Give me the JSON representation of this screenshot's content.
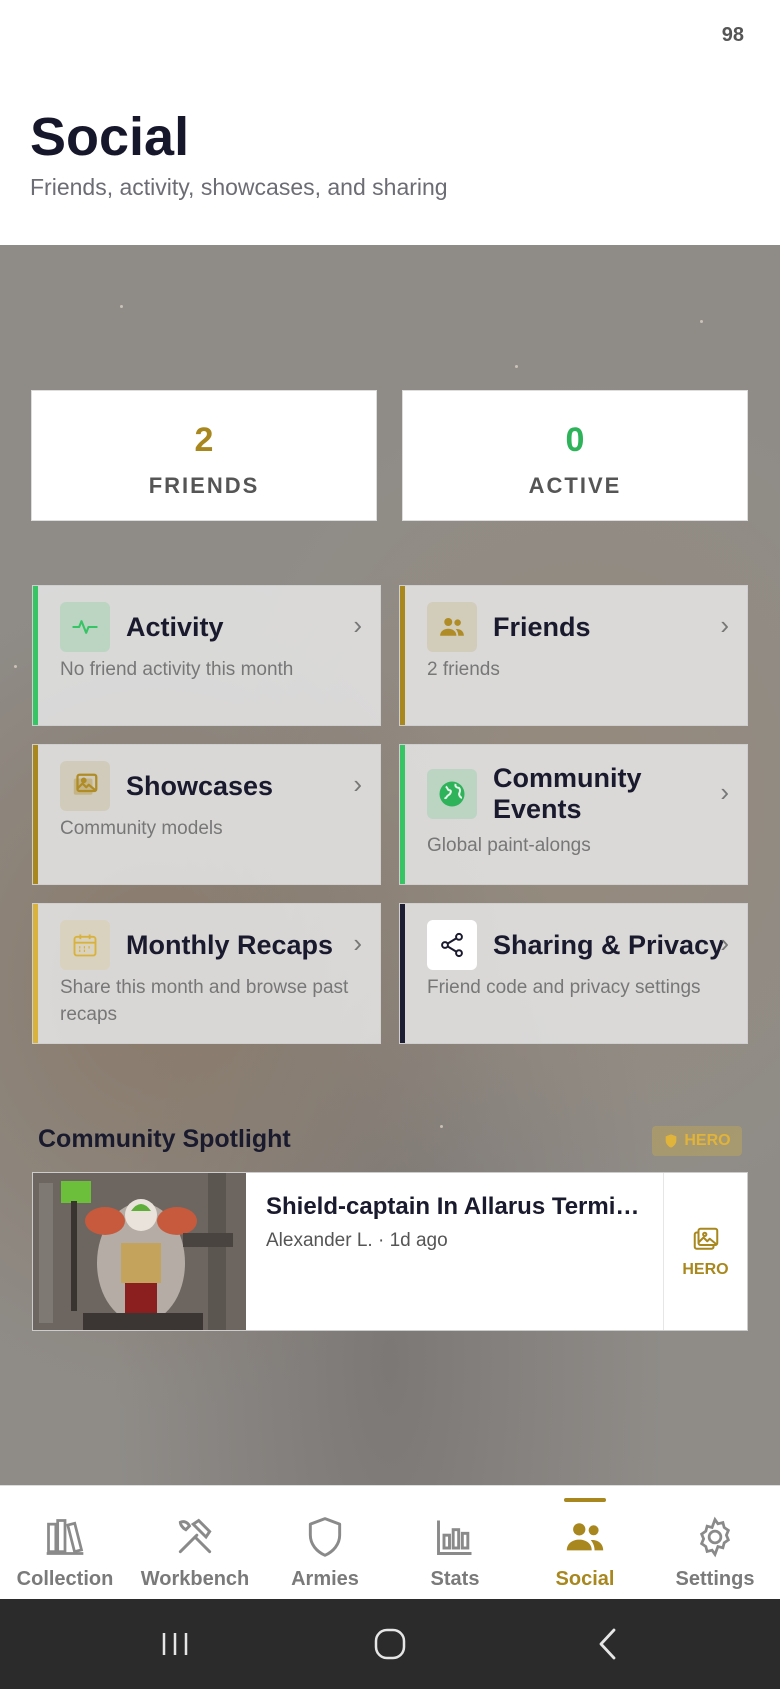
{
  "status_bar": {
    "battery": "98"
  },
  "header": {
    "title": "Social",
    "subtitle": "Friends, activity, showcases, and sharing"
  },
  "stats": [
    {
      "value": "2",
      "label": "FRIENDS",
      "color": "#a8871e"
    },
    {
      "value": "0",
      "label": "ACTIVE",
      "color": "#2fb35a"
    }
  ],
  "cards": [
    {
      "title": "Activity",
      "description": "No friend activity this month",
      "accent": "#36c464",
      "icon": "activity-pulse-icon"
    },
    {
      "title": "Friends",
      "description": "2 friends",
      "accent": "#a8871e",
      "icon": "people-icon"
    },
    {
      "title": "Showcases",
      "description": "Community models",
      "accent": "#a8871e",
      "icon": "image-icon"
    },
    {
      "title": "Community Events",
      "description": "Global paint-alongs",
      "accent": "#36c464",
      "icon": "globe-icon"
    },
    {
      "title": "Monthly Recaps",
      "description": "Share this month and browse past recaps",
      "accent": "#d9b23e",
      "icon": "calendar-icon"
    },
    {
      "title": "Sharing & Privacy",
      "description": "Friend code and privacy settings",
      "accent": "#1d1d33",
      "icon": "share-icon"
    }
  ],
  "spotlight": {
    "heading": "Community Spotlight",
    "badge": "HERO",
    "item": {
      "name": "Shield-captain In Allarus Terminator Armour",
      "meta": "Alexander L. · 1d ago",
      "side_label": "HERO"
    }
  },
  "tabs": [
    {
      "label": "Collection",
      "icon": "books-icon"
    },
    {
      "label": "Workbench",
      "icon": "tools-icon"
    },
    {
      "label": "Armies",
      "icon": "shield-icon"
    },
    {
      "label": "Stats",
      "icon": "bar-chart-icon"
    },
    {
      "label": "Social",
      "icon": "people-icon",
      "active": true
    },
    {
      "label": "Settings",
      "icon": "gear-icon"
    }
  ],
  "colors": {
    "accent_gold": "#a8871e",
    "accent_green": "#2fb35a",
    "navy": "#17172b"
  }
}
